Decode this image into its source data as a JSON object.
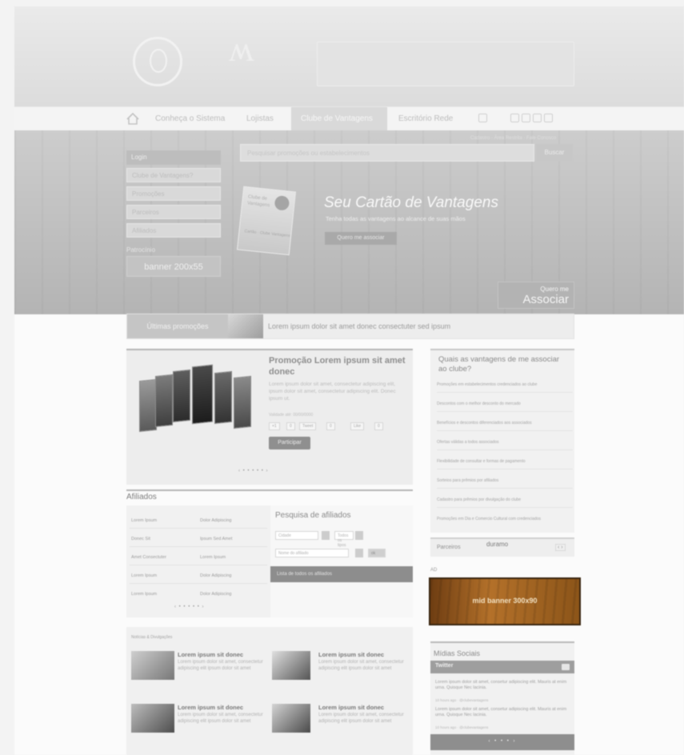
{
  "header": {
    "banner_text": "",
    "logo_glyph": "ʍ"
  },
  "nav": {
    "items": [
      "Início",
      "Conheça o Sistema",
      "Lojistas",
      "Clube de Vantagens",
      "Escritório Rede"
    ],
    "active_label": "Clube de Vantagens"
  },
  "hero": {
    "side_header": "Login",
    "side_fields": [
      "Clube de Vantagens?",
      "Promoções",
      "Parceiros",
      "Afiliados"
    ],
    "side_patrocinio": "Patrocínio",
    "side_banner": "banner 200x55",
    "search_placeholder": "Pesquisar promoções ou estabelecimentos",
    "search_button": "Buscar",
    "top_links": "Cadastro · Área Restrita · Fale Conosco",
    "card_line1": "Clube de",
    "card_line2": "Vantagens",
    "card_bottom": "Cartão · Clube Vantagens",
    "title": "Seu Cartão de Vantagens",
    "subtitle": "Tenha todas as vantagens ao alcance de suas mãos",
    "cta": "Quero me associar",
    "assoc_line1": "Quero me",
    "assoc_line2": "Associar"
  },
  "promo_strip": {
    "label": "Últimas promoções",
    "text": "Lorem ipsum dolor sit amet donec consectuter sed ipsum"
  },
  "featured": {
    "title": "Promoção Lorem ipsum sit amet donec",
    "description": "Lorem ipsum dolor sit amet, consectetur adipiscing elit, ipsum dolor sit amet, consectetur adipiscing elit. Donec ipsum ut.",
    "meta": "Validade até: 00/00/0000",
    "share": [
      "+1",
      "0",
      "Tweet",
      "0",
      "Like",
      "0"
    ],
    "button": "Participar",
    "pager": "‹ • • • • • ›"
  },
  "questions": {
    "title": "Quais as vantagens de me associar ao clube?",
    "items": [
      "Promoções em estabelecimentos credenciados ao clube",
      "Descontos com o melhor desconto do mercado",
      "Benefícios e descontos diferenciados aos associados",
      "Ofertas válidas a todos associados",
      "Flexibilidade de consultar e formas de pagamento",
      "Sorteios para prêmios por afiliados",
      "Cadastro para prêmios por divulgação do clube",
      "Promoções em Dia e Comercio Cultural com credenciados"
    ]
  },
  "partners": {
    "label": "Parceiros",
    "logo": "duramo",
    "arrows": "‹ ›"
  },
  "ad": {
    "label": "AD",
    "banner": "mid banner 300x90"
  },
  "affiliates": {
    "title": "Afiliados",
    "rows": [
      [
        "Lorem Ipsum",
        "Dolor Adipiscing"
      ],
      [
        "Donec Sit",
        "Ipsum Sed Amet"
      ],
      [
        "Amet Consectuter",
        "Lorem Ipsum"
      ],
      [
        "Lorem Ipsum",
        "Dolor Adipiscing"
      ],
      [
        "Lorem Ipsum",
        "Dolor Adipiscing"
      ]
    ],
    "pager": "‹ • • • • • ›",
    "search_title": "Pesquisa de afiliados",
    "field_city": "Cidade",
    "field_type": "Todos os tipos",
    "field_name": "Nome do afiliado",
    "search_go": "ok",
    "list_button": "Lista de todos os afiliados"
  },
  "news": {
    "label": "Notícias & Divulgações",
    "items": [
      {
        "title": "Lorem ipsum sit donec",
        "desc": "Lorem ipsum dolor sit amet, consectetur adipiscing elit ipsum dolor sit amet"
      },
      {
        "title": "Lorem ipsum sit donec",
        "desc": "Lorem ipsum dolor sit amet, consectetur adipiscing elit ipsum dolor sit amet"
      },
      {
        "title": "Lorem ipsum sit donec",
        "desc": "Lorem ipsum dolor sit amet, consectetur adipiscing elit ipsum dolor sit amet"
      },
      {
        "title": "Lorem ipsum sit donec",
        "desc": "Lorem ipsum dolor sit amet, consectetur adipiscing elit ipsum dolor sit amet"
      }
    ]
  },
  "social": {
    "title": "Mídias Sociais",
    "network": "Twitter",
    "tweets": [
      {
        "text": "Lorem ipsum dolor sit amet, consetur adipiscing elit. Mauris at enim urna. Quisque Nec lacinia.",
        "meta": "10 hours ago · @clubevantagens"
      },
      {
        "text": "Lorem ipsum dolor sit amet, consetur adipiscing elit. Mauris at enim urna. Quisque Nec lacinia.",
        "meta": "10 hours ago · @clubevantagens"
      }
    ],
    "pager": "‹ • • • ›"
  }
}
